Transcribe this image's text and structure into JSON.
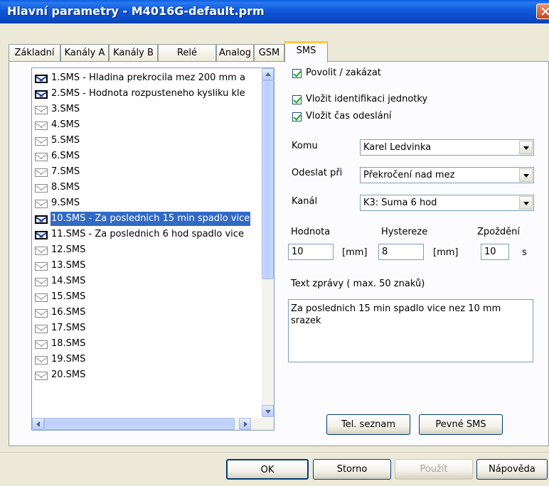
{
  "window": {
    "title": "Hlavní parametry - M4016G-default.prm"
  },
  "tabs": [
    {
      "label": "Základní"
    },
    {
      "label": "Kanály A"
    },
    {
      "label": "Kanály B"
    },
    {
      "label": "Relé"
    },
    {
      "label": "Analog"
    },
    {
      "label": "GSM"
    },
    {
      "label": "SMS"
    }
  ],
  "sms_list": [
    {
      "label": "1.SMS - Hladina prekrocila mez 200 mm a",
      "active": true
    },
    {
      "label": "2.SMS - Hodnota rozpusteneho kysliku kle",
      "active": true
    },
    {
      "label": "3.SMS",
      "active": false
    },
    {
      "label": "4.SMS",
      "active": false
    },
    {
      "label": "5.SMS",
      "active": false
    },
    {
      "label": "6.SMS",
      "active": false
    },
    {
      "label": "7.SMS",
      "active": false
    },
    {
      "label": "8.SMS",
      "active": false
    },
    {
      "label": "9.SMS",
      "active": false
    },
    {
      "label": "10.SMS - Za poslednich 15 min spadlo vice",
      "active": true,
      "selected": true
    },
    {
      "label": "11.SMS - Za poslednich 6 hod spadlo vice",
      "active": true
    },
    {
      "label": "12.SMS",
      "active": false
    },
    {
      "label": "13.SMS",
      "active": false
    },
    {
      "label": "14.SMS",
      "active": false
    },
    {
      "label": "15.SMS",
      "active": false
    },
    {
      "label": "16.SMS",
      "active": false
    },
    {
      "label": "17.SMS",
      "active": false
    },
    {
      "label": "18.SMS",
      "active": false
    },
    {
      "label": "19.SMS",
      "active": false
    },
    {
      "label": "20.SMS",
      "active": false
    }
  ],
  "options": {
    "enable": {
      "label": "Povolit / zakázat",
      "checked": true
    },
    "insert_id": {
      "label": "Vložit identifikaci jednotky",
      "checked": true
    },
    "insert_time": {
      "label": "Vložit čas odeslání",
      "checked": true
    }
  },
  "fields": {
    "to_label": "Komu",
    "to_value": "Karel Ledvinka",
    "send_on_label": "Odeslat při",
    "send_on_value": "Překročení nad mez",
    "channel_label": "Kanál",
    "channel_value": "K3: Suma 6 hod",
    "value_label": "Hodnota",
    "value": "10",
    "value_unit": "[mm]",
    "hysteresis_label": "Hystereze",
    "hysteresis": "8",
    "hysteresis_unit": "[mm]",
    "delay_label": "Zpoždění",
    "delay": "10",
    "delay_unit": "s",
    "message_label": "Text zprávy ( max. 50 znaků)",
    "message": "Za poslednich 15 min spadlo vice nez 10 mm srazek"
  },
  "panel_buttons": {
    "phonebook": "Tel. seznam",
    "fixed_sms": "Pevné SMS"
  },
  "footer_buttons": {
    "ok": "OK",
    "cancel": "Storno",
    "apply": "Použít",
    "help": "Nápověda"
  },
  "colors": {
    "titlebar": "#0a4cc9",
    "selection": "#316ac5",
    "tab_highlight": "#ffc83c"
  }
}
